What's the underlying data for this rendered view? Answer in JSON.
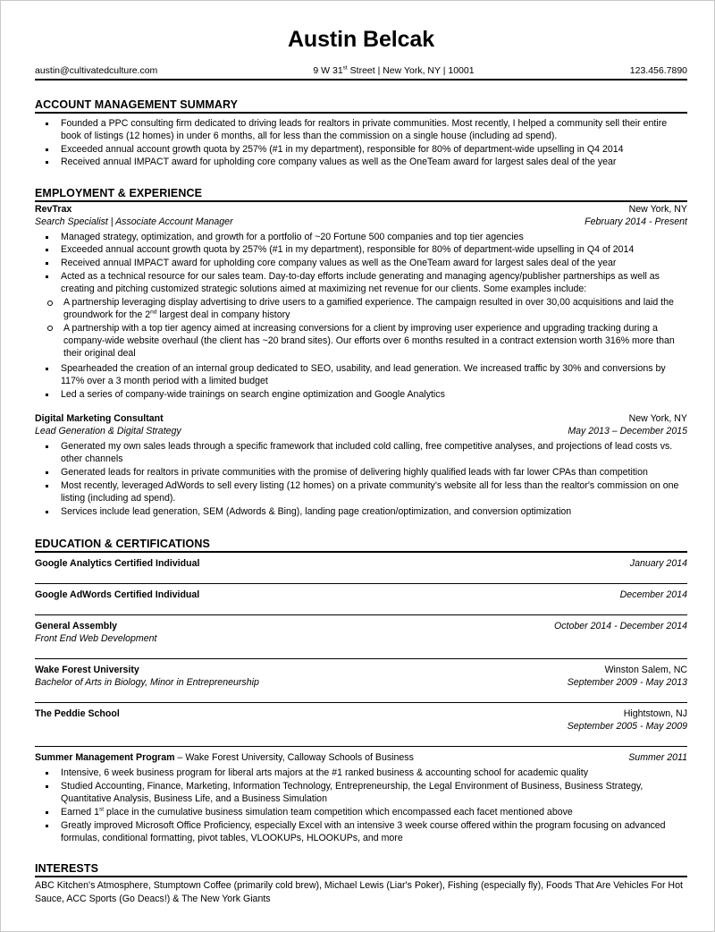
{
  "header": {
    "name": "Austin Belcak",
    "email": "austin@cultivatedculture.com",
    "address_pre": "9 W 31",
    "address_sup": "st",
    "address_post": " Street | New York, NY | 10001",
    "phone": "123.456.7890"
  },
  "summary": {
    "title": "ACCOUNT MANAGEMENT SUMMARY",
    "bullets": [
      "Founded a PPC consulting firm dedicated to driving leads for realtors in private communities. Most recently, I helped a community sell their entire book of listings (12 homes) in under 6 months, all for less than the commission on a single house (including ad spend).",
      "Exceeded annual account growth quota by 257% (#1 in my department), responsible for 80% of department-wide upselling in Q4 2014",
      "Received annual IMPACT award for upholding core company values as well as the OneTeam award for largest sales deal of the year"
    ]
  },
  "employment": {
    "title": "EMPLOYMENT & EXPERIENCE",
    "jobs": [
      {
        "org": "RevTrax",
        "location": "New York, NY",
        "role": "Search Specialist | Associate Account Manager",
        "dates": "February 2014 - Present",
        "bullets": [
          "Managed strategy, optimization, and growth for a portfolio of ~20 Fortune 500 companies and top tier agencies",
          "Exceeded annual account growth quota by 257% (#1 in my department), responsible for 80% of department-wide upselling in Q4 of 2014",
          "Received annual IMPACT award for upholding core company values as well as the OneTeam award for largest sales deal of the year",
          "Acted as a technical resource for our sales team. Day-to-day efforts include generating and managing agency/publisher partnerships as well as creating and pitching customized strategic solutions aimed at maximizing net revenue for our clients. Some examples include:"
        ],
        "sub_bullets": [
          {
            "pre": "A partnership leveraging display advertising to drive users to a gamified experience. The campaign resulted in over 30,00 acquisitions and laid the groundwork for the 2",
            "sup": "nd",
            "post": " largest deal in company history"
          },
          {
            "pre": "A partnership with a top tier agency aimed at increasing conversions for a client by improving user experience and upgrading tracking during a company-wide website overhaul (the client has ~20 brand sites). Our efforts over 6 months resulted in a contract extension worth 316% more than their original deal",
            "sup": "",
            "post": ""
          }
        ],
        "bullets_after": [
          "Spearheaded the creation of an internal group dedicated to SEO, usability, and lead generation. We increased traffic by 30% and conversions by 117% over a 3 month period with a limited budget",
          "Led a series of company-wide trainings on search engine optimization and Google Analytics"
        ]
      },
      {
        "org": "Digital Marketing Consultant",
        "location": "New York, NY",
        "role": "Lead Generation & Digital Strategy",
        "dates": "May 2013 – December 2015",
        "bullets": [
          "Generated my own sales leads through a specific framework that included cold calling, free competitive analyses, and projections of lead costs vs. other channels",
          "Generated leads for realtors in private communities with the promise of delivering highly qualified leads with far lower CPAs than competition",
          "Most recently, leveraged AdWords to sell every listing (12 homes) on a private community's website all for less than the realtor's commission on one listing (including ad spend).",
          "Services include lead generation, SEM (Adwords & Bing), landing page creation/optimization, and conversion optimization"
        ],
        "sub_bullets": [],
        "bullets_after": []
      }
    ]
  },
  "education": {
    "title": "EDUCATION & CERTIFICATIONS",
    "entries": [
      {
        "org": "Google Analytics Certified Individual",
        "location": "",
        "role": "",
        "dates": "January 2014"
      },
      {
        "org": "Google AdWords Certified Individual",
        "location": "",
        "role": "",
        "dates": "December 2014"
      },
      {
        "org": "General Assembly",
        "location": "October 2014 - December 2014",
        "role": "Front End Web Development",
        "dates": ""
      },
      {
        "org": "Wake Forest University",
        "location": "Winston Salem, NC",
        "role": "Bachelor of Arts in Biology, Minor in Entrepreneurship",
        "dates": "September 2009 - May 2013"
      },
      {
        "org": "The Peddie School",
        "location": "Hightstown, NJ",
        "role": "",
        "dates": "September 2005 - May 2009"
      }
    ],
    "program": {
      "title_bold": "Summer Management Program ",
      "title_rest": "– Wake Forest University, Calloway Schools of Business",
      "dates": "Summer 2011",
      "bullets": [
        {
          "pre": "Intensive, 6 week business program for liberal arts majors at the #1 ranked business & accounting school for academic quality",
          "sup": "",
          "post": ""
        },
        {
          "pre": "Studied Accounting, Finance, Marketing, Information Technology, Entrepreneurship, the Legal Environment of Business, Business Strategy, Quantitative Analysis, Business Life, and a Business Simulation",
          "sup": "",
          "post": ""
        },
        {
          "pre": "Earned 1",
          "sup": "st",
          "post": " place in the cumulative business simulation team competition which encompassed each facet mentioned above"
        },
        {
          "pre": "Greatly improved Microsoft Office Proficiency, especially Excel with an intensive 3 week course offered within the program focusing on advanced formulas, conditional formatting, pivot tables, VLOOKUPs, HLOOKUPs, and more",
          "sup": "",
          "post": ""
        }
      ]
    }
  },
  "interests": {
    "title": "INTERESTS",
    "body": "ABC Kitchen's Atmosphere, Stumptown Coffee (primarily cold brew), Michael Lewis (Liar's Poker), Fishing (especially fly), Foods That Are Vehicles For Hot Sauce, ACC Sports (Go Deacs!) & The New York Giants"
  }
}
